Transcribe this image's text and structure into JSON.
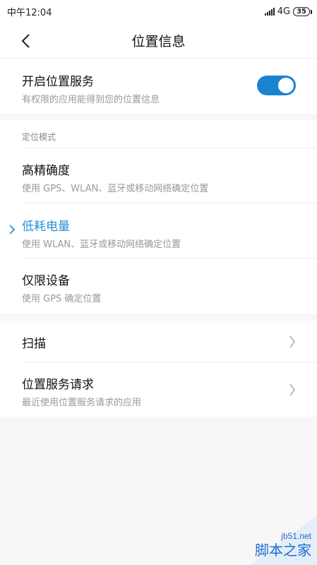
{
  "status_bar": {
    "time": "中午12:04",
    "network": "4G",
    "battery": "35"
  },
  "nav": {
    "title": "位置信息"
  },
  "location_service": {
    "title": "开启位置服务",
    "subtitle": "有权限的应用能得到您的位置信息",
    "enabled": true
  },
  "mode_section": {
    "label": "定位模式",
    "options": [
      {
        "title": "高精确度",
        "subtitle": "使用 GPS、WLAN、蓝牙或移动网络确定位置",
        "selected": false
      },
      {
        "title": "低耗电量",
        "subtitle": "使用 WLAN、蓝牙或移动网络确定位置",
        "selected": true
      },
      {
        "title": "仅限设备",
        "subtitle": "使用 GPS 确定位置",
        "selected": false
      }
    ]
  },
  "other": {
    "scan": {
      "title": "扫描"
    },
    "requests": {
      "title": "位置服务请求",
      "subtitle": "最近使用位置服务请求的应用"
    }
  },
  "watermark": {
    "url": "jb51.net",
    "text": "脚本之家"
  },
  "colors": {
    "accent": "#1b82d2",
    "selected": "#2b8fd6"
  }
}
